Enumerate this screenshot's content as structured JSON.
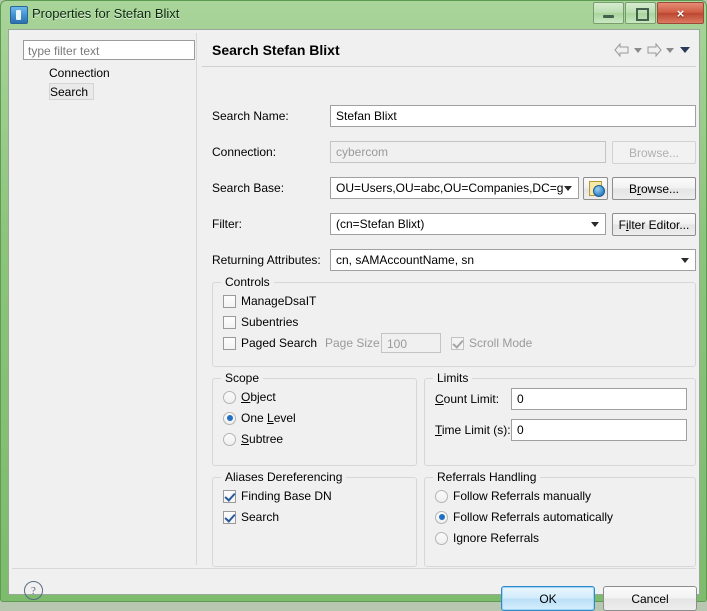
{
  "window": {
    "title": "Properties for Stefan Blixt",
    "icon": "app-icon",
    "minimize_label": "",
    "maximize_label": "",
    "close_label": "×"
  },
  "sidebar": {
    "filter_placeholder": "type filter text",
    "filter_value": "",
    "items": [
      {
        "label": "Connection",
        "selected": false
      },
      {
        "label": "Search",
        "selected": true
      }
    ]
  },
  "content": {
    "title": "Search Stefan Blixt",
    "nav": {
      "back_icon": "back-arrow-icon",
      "back_menu_icon": "chevron-down-icon",
      "forward_icon": "forward-arrow-icon",
      "forward_menu_icon": "chevron-down-icon",
      "view_menu_icon": "view-menu-triangle-icon"
    },
    "fields": {
      "search_name": {
        "label": "Search Name:",
        "value": "Stefan Blixt"
      },
      "connection": {
        "label": "Connection:",
        "value": "cybercom",
        "disabled": true,
        "browse_label": "Browse...",
        "browse_disabled": true
      },
      "search_base": {
        "label": "Search Base:",
        "value": "OU=Users,OU=abc,OU=Companies,DC=ɡ",
        "picker_icon": "ldap-browse-icon",
        "browse_label": "Browse...",
        "browse_mnemonic": "o"
      },
      "filter": {
        "label": "Filter:",
        "value": "(cn=Stefan Blixt)",
        "editor_label": "Filter Editor...",
        "editor_mnemonic": "i"
      },
      "returning_attributes": {
        "label": "Returning Attributes:",
        "value": "cn, sAMAccountName, sn"
      }
    },
    "controls": {
      "title": "Controls",
      "manage_dsa_it": {
        "label": "ManageDsaIT",
        "checked": false
      },
      "subentries": {
        "label": "Subentries",
        "checked": false
      },
      "paged_search": {
        "label": "Paged Search",
        "checked": false
      },
      "page_size": {
        "label": "Page Size:",
        "value": "100",
        "disabled": true
      },
      "scroll_mode": {
        "label": "Scroll Mode",
        "checked": true,
        "disabled": true
      }
    },
    "scope": {
      "title": "Scope",
      "options": [
        {
          "label": "Object",
          "selected": false
        },
        {
          "label": "One Level",
          "selected": true
        },
        {
          "label": "Subtree",
          "selected": false
        }
      ]
    },
    "limits": {
      "title": "Limits",
      "count_limit": {
        "label": "Count Limit:",
        "value": "0"
      },
      "time_limit": {
        "label": "Time Limit (s):",
        "value": "0"
      }
    },
    "aliases": {
      "title": "Aliases Dereferencing",
      "finding_base_dn": {
        "label": "Finding Base DN",
        "checked": true
      },
      "search": {
        "label": "Search",
        "checked": true
      }
    },
    "referrals": {
      "title": "Referrals Handling",
      "options": [
        {
          "label": "Follow Referrals manually",
          "selected": false
        },
        {
          "label": "Follow Referrals automatically",
          "selected": true
        },
        {
          "label": "Ignore Referrals",
          "selected": false
        }
      ]
    }
  },
  "footer": {
    "help_icon": "help-question-icon",
    "ok_label": "OK",
    "cancel_label": "Cancel"
  },
  "colors": {
    "frame": "#8cc47c",
    "accent": "#2e8ccc",
    "close": "#cf5b42",
    "selection": "#1f6fc4"
  }
}
